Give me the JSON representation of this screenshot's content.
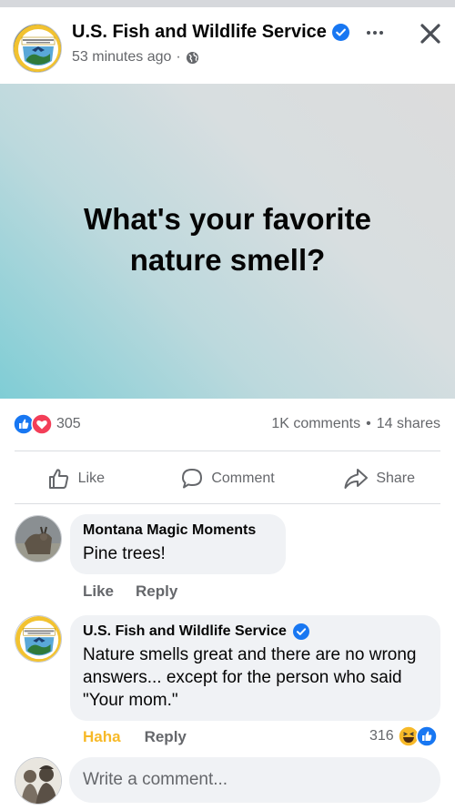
{
  "post": {
    "page_name": "U.S. Fish and Wildlife Service",
    "time_ago": "53 minutes ago",
    "separator": "·",
    "post_text": "What's your favorite nature smell?",
    "reaction_count": "305",
    "comments_count": "1K comments",
    "stats_separator": "•",
    "shares_count": "14 shares"
  },
  "actions": {
    "like": "Like",
    "comment": "Comment",
    "share": "Share"
  },
  "comments": [
    {
      "author": "Montana Magic Moments",
      "text": "Pine trees!",
      "like_label": "Like",
      "reply_label": "Reply"
    },
    {
      "author": "U.S. Fish and Wildlife Service",
      "text": "Nature smells great and there are no wrong answers... except for the person who said \"Your mom.\"",
      "reaction_label": "Haha",
      "reply_label": "Reply",
      "reaction_count": "316"
    }
  ],
  "composer": {
    "placeholder": "Write a comment..."
  },
  "colors": {
    "verified_blue": "#1877f2",
    "haha_yellow": "#f7b928",
    "love_red": "#f33e58"
  },
  "icons": [
    "verified-icon",
    "globe-icon",
    "more-icon",
    "close-icon",
    "like-reaction-icon",
    "love-reaction-icon",
    "haha-reaction-icon",
    "thumbs-up-icon",
    "comment-icon",
    "share-icon"
  ]
}
